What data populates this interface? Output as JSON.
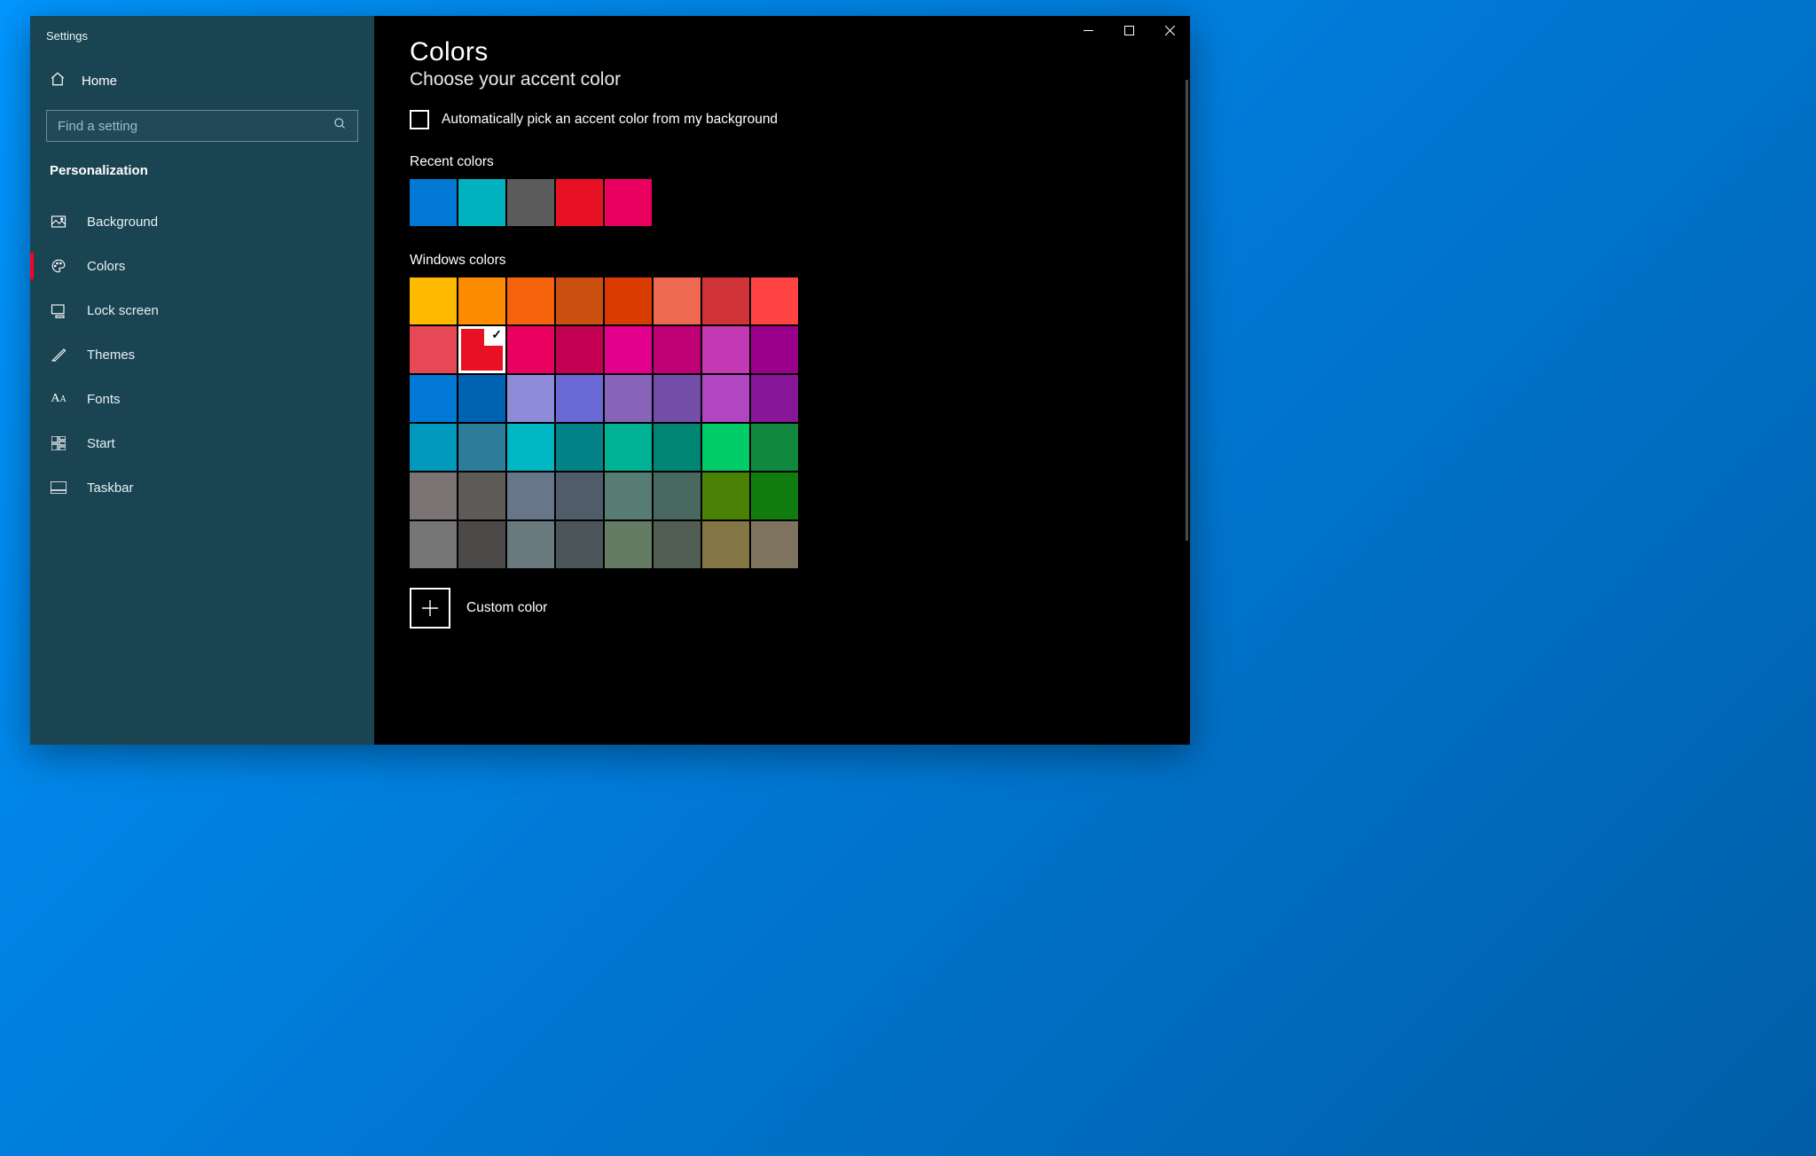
{
  "app_title": "Settings",
  "sidebar": {
    "home_label": "Home",
    "search_placeholder": "Find a setting",
    "section_title": "Personalization",
    "items": [
      {
        "label": "Background",
        "icon": "image-icon",
        "active": false
      },
      {
        "label": "Colors",
        "icon": "palette-icon",
        "active": true
      },
      {
        "label": "Lock screen",
        "icon": "lockscreen-icon",
        "active": false
      },
      {
        "label": "Themes",
        "icon": "paintbrush-icon",
        "active": false
      },
      {
        "label": "Fonts",
        "icon": "font-icon",
        "active": false
      },
      {
        "label": "Start",
        "icon": "start-icon",
        "active": false
      },
      {
        "label": "Taskbar",
        "icon": "taskbar-icon",
        "active": false
      }
    ]
  },
  "main": {
    "heading": "Colors",
    "subtitle": "Choose your accent color",
    "auto_pick_label": "Automatically pick an accent color from my background",
    "auto_pick_checked": false,
    "recent_label": "Recent colors",
    "recent_colors": [
      "#0078d4",
      "#00b2bd",
      "#5b5b5b",
      "#e81123",
      "#ea005e"
    ],
    "windows_label": "Windows colors",
    "windows_colors": [
      "#ffb900",
      "#ff8c00",
      "#f7630c",
      "#ca5010",
      "#da3b01",
      "#ef6950",
      "#d13438",
      "#ff4343",
      "#e74856",
      "#e81123",
      "#ea005e",
      "#c30052",
      "#e3008c",
      "#bf0077",
      "#c239b3",
      "#9a0089",
      "#0078d4",
      "#0063b1",
      "#8e8cd8",
      "#6b69d6",
      "#8764b8",
      "#744da9",
      "#b146c2",
      "#881798",
      "#0099bc",
      "#2d7d9a",
      "#00b7c3",
      "#038387",
      "#00b294",
      "#018574",
      "#00cc6a",
      "#10893e",
      "#7a7574",
      "#5d5a58",
      "#68768a",
      "#515c6b",
      "#567c73",
      "#486860",
      "#498205",
      "#107c10",
      "#767676",
      "#4c4a48",
      "#69797e",
      "#4a5459",
      "#647c64",
      "#525e54",
      "#847545",
      "#7e735f"
    ],
    "selected_windows_index": 9,
    "custom_label": "Custom color"
  }
}
